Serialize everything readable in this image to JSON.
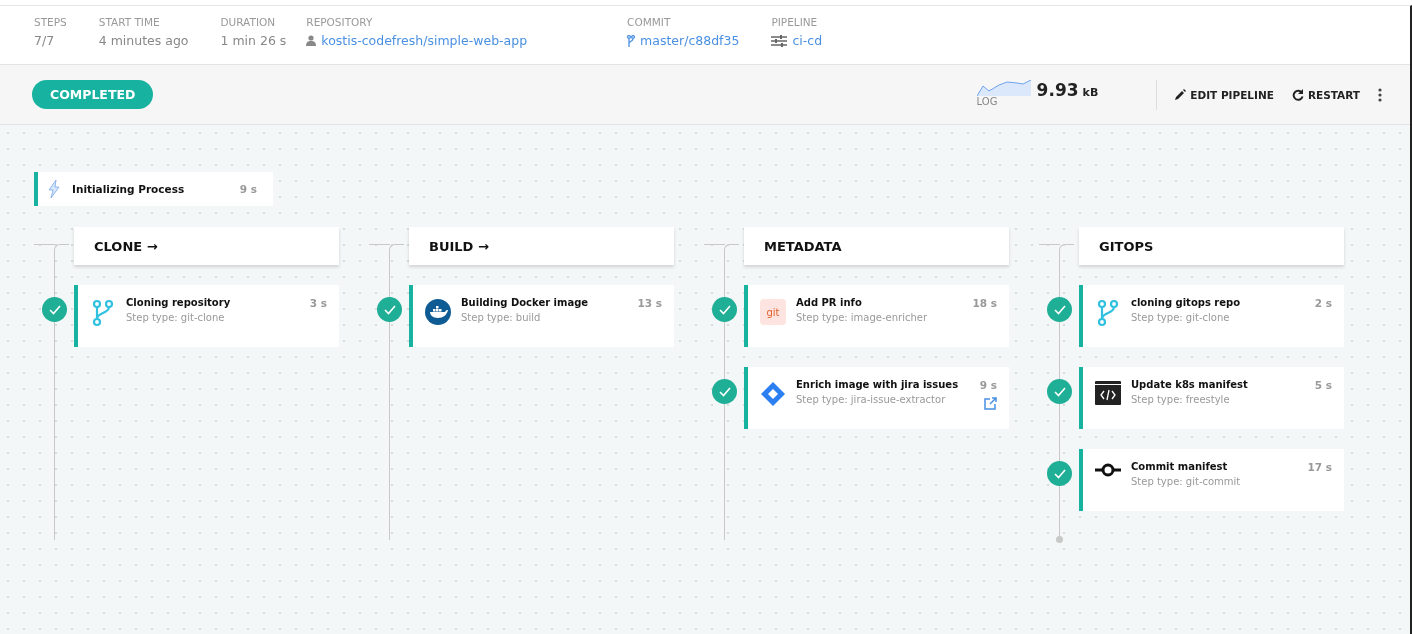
{
  "summary": [
    {
      "label": "STEPS",
      "value": "7/7",
      "kind": "plain"
    },
    {
      "label": "START TIME",
      "value": "4 minutes ago",
      "kind": "plain"
    },
    {
      "label": "DURATION",
      "value": "1 min 26 s",
      "kind": "plain"
    },
    {
      "label": "REPOSITORY",
      "value": "kostis-codefresh/simple-web-app",
      "kind": "repo"
    },
    {
      "label": "COMMIT",
      "value": "master/c88df35",
      "kind": "commit"
    },
    {
      "label": "PIPELINE",
      "value": "ci-cd",
      "kind": "pipeline"
    }
  ],
  "status": "COMPLETED",
  "log": {
    "label": "LOG",
    "size": "9.93",
    "unit": "kB"
  },
  "actions": [
    {
      "label": "EDIT PIPELINE",
      "kind": "edit"
    },
    {
      "label": "RESTART",
      "kind": "restart"
    }
  ],
  "init": {
    "name": "Initializing Process",
    "duration": "9 s"
  },
  "stages": [
    {
      "title": "CLONE →",
      "steps": [
        {
          "name": "Cloning repository",
          "type": "Step type: git-clone",
          "duration": "3 s",
          "kind": "branch",
          "link": false
        }
      ]
    },
    {
      "title": "BUILD →",
      "steps": [
        {
          "name": "Building Docker image",
          "type": "Step type: build",
          "duration": "13 s",
          "kind": "docker",
          "link": false
        }
      ]
    },
    {
      "title": "METADATA",
      "steps": [
        {
          "name": "Add PR info",
          "type": "Step type: image-enricher",
          "duration": "18 s",
          "kind": "git",
          "link": false
        },
        {
          "name": "Enrich image with jira issues",
          "type": "Step type: jira-issue-extractor",
          "duration": "9 s",
          "kind": "jira",
          "link": true
        }
      ]
    },
    {
      "title": "GITOPS",
      "steps": [
        {
          "name": "cloning gitops repo",
          "type": "Step type: git-clone",
          "duration": "2 s",
          "kind": "branch",
          "link": false
        },
        {
          "name": "Update k8s manifest",
          "type": "Step type: freestyle",
          "duration": "5 s",
          "kind": "code",
          "link": false
        },
        {
          "name": "Commit manifest",
          "type": "Step type: git-commit",
          "duration": "17 s",
          "kind": "commit",
          "link": false
        }
      ]
    }
  ]
}
